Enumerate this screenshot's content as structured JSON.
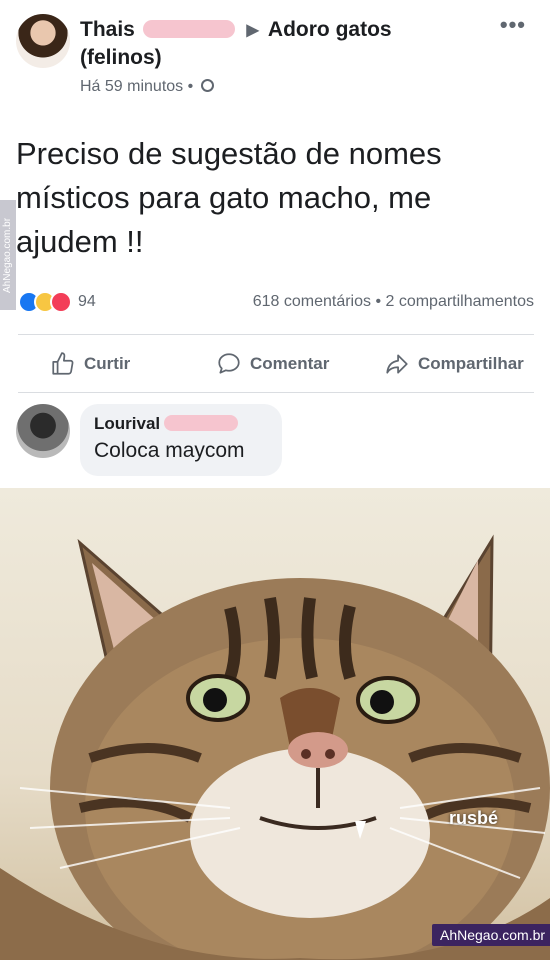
{
  "post": {
    "author_name": "Thais",
    "group_name": "Adoro gatos",
    "group_suffix": "(felinos)",
    "timestamp": "Há 59 minutos",
    "body": "Preciso de sugestão de nomes místicos para gato macho, me ajudem !!"
  },
  "reactions": {
    "count": "94",
    "stats": "618 comentários • 2 compartilhamentos"
  },
  "actions": {
    "like": "Curtir",
    "comment": "Comentar",
    "share": "Compartilhar"
  },
  "comment": {
    "author": "Lourival",
    "text": "Coloca maycom"
  },
  "image": {
    "caption": "rusbé",
    "watermark": "AhNegao.com.br",
    "side_watermark": "AhNegao.com.br"
  },
  "colors": {
    "text": "#1c1e21",
    "secondary": "#606770",
    "bubble": "#f0f2f5",
    "redaction": "#f6c5cf"
  }
}
